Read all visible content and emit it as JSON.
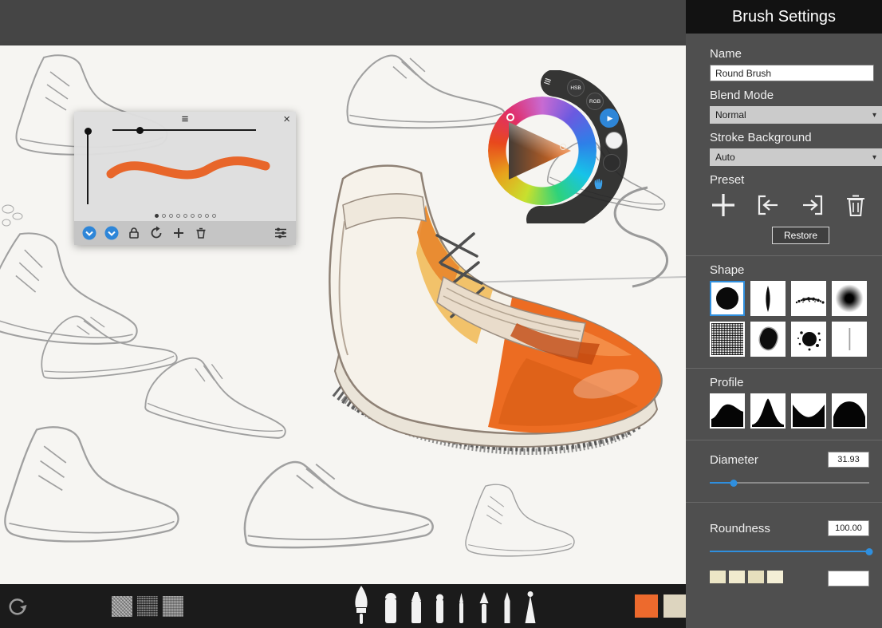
{
  "sidebar": {
    "title": "Brush Settings",
    "name": {
      "label": "Name",
      "value": "Round Brush"
    },
    "blend_mode": {
      "label": "Blend Mode",
      "value": "Normal"
    },
    "stroke_background": {
      "label": "Stroke Background",
      "value": "Auto"
    },
    "preset": {
      "label": "Preset",
      "restore_label": "Restore"
    },
    "shape_label": "Shape",
    "profile_label": "Profile",
    "diameter": {
      "label": "Diameter",
      "value": "31.93"
    },
    "roundness": {
      "label": "Roundness",
      "value": "100.00"
    }
  },
  "color_wheel": {
    "hsb_label": "HSB",
    "rgb_label": "RGB"
  },
  "glyphs": {
    "close": "×",
    "handle": "≡",
    "chevron": "▾",
    "play": "▶"
  },
  "colors": {
    "accent_blue": "#2f8fde",
    "stroke_orange": "#ed6a2d",
    "swatch_orange": "#ed6a2d",
    "swatch_beige": "#ddd5bf",
    "sidebar_bg": "#4f4f4f",
    "toolbar_bg": "#1b1b1b"
  }
}
